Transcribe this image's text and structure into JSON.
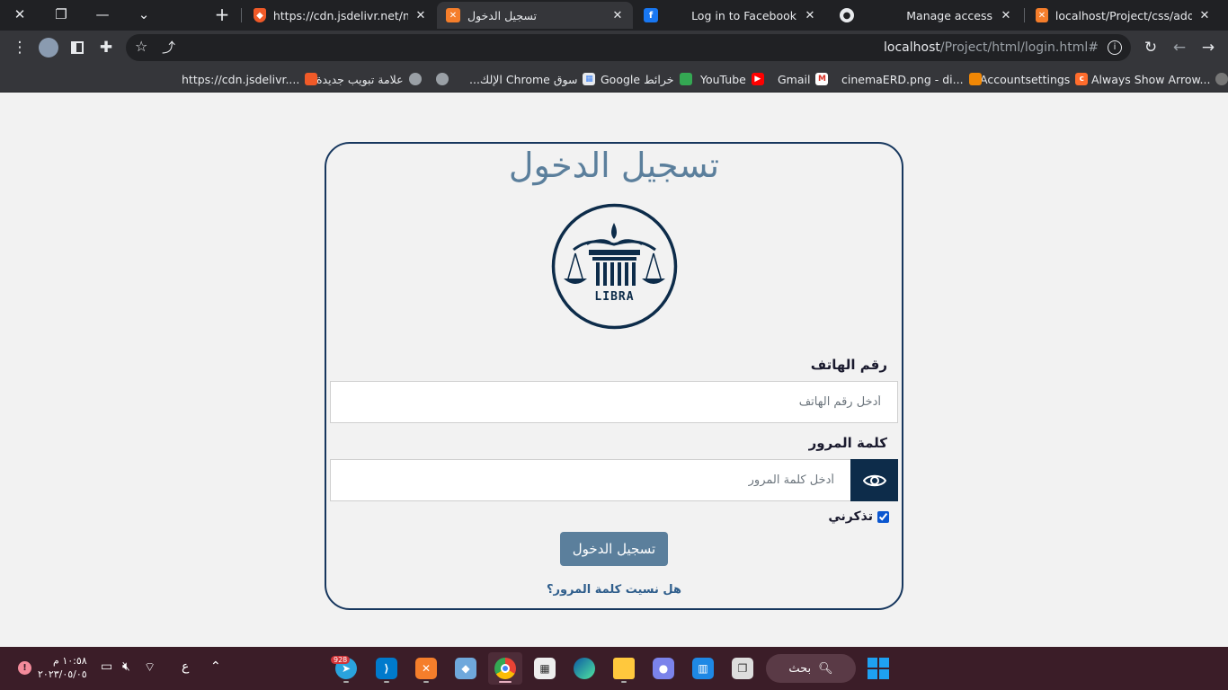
{
  "browser": {
    "tabs": [
      {
        "title": "https://cdn.jsdelivr.net/npm/",
        "favicon": "brave-shield-icon"
      },
      {
        "title": "تسجيل الدخول",
        "favicon": "xampp-icon",
        "active": true
      },
      {
        "title": "Log in to Facebook",
        "favicon": "facebook-icon"
      },
      {
        "title": "Manage access",
        "favicon": "github-icon"
      },
      {
        "title": "localhost/Project/css/add_ac",
        "favicon": "xampp-icon"
      }
    ],
    "url_host": "localhost",
    "url_path": "/Project/html/login.html#",
    "bookmarks": [
      {
        "label": "Always Show Arrow...",
        "icon": "puzzle-icon"
      },
      {
        "label": "Accountsettings",
        "icon": "cpanel-icon"
      },
      {
        "label": "cinemaERD.png - di...",
        "icon": "drawio-icon"
      },
      {
        "label": "Gmail",
        "icon": "gmail-icon"
      },
      {
        "label": "YouTube",
        "icon": "youtube-icon"
      },
      {
        "label": "خرائط Google",
        "icon": "maps-icon"
      },
      {
        "label": "سوق Chrome الإلك...",
        "icon": "webstore-icon"
      },
      {
        "label": "",
        "icon": "globe-icon"
      },
      {
        "label": "علامة تبويب جديدة",
        "icon": "globe-icon"
      },
      {
        "label": "https://cdn.jsdelivr....",
        "icon": "brave-shield-icon"
      }
    ]
  },
  "login": {
    "title": "تسجيل الدخول",
    "logo_text": "LIBRA",
    "phone_label": "رقم الهاتف",
    "phone_placeholder": "أدخل رقم الهاتف",
    "password_label": "كلمة المرور",
    "password_placeholder": "أدخل كلمة المرور",
    "remember_label": "تذكرني",
    "remember_checked": true,
    "submit_label": "تسجيل الدخول",
    "forgot_link": "هل نسيت كلمة المرور؟"
  },
  "taskbar": {
    "search_label": "بحث",
    "telegram_badge": "928",
    "time": "١٠:٥٨ م",
    "date": "٢٠٢٣/٠٥/٠٥",
    "language": "ع"
  },
  "colors": {
    "accent": "#5b7f9c",
    "card_border": "#17375e",
    "eye_button": "#0d2c4a",
    "taskbar": "#3b1d28"
  }
}
